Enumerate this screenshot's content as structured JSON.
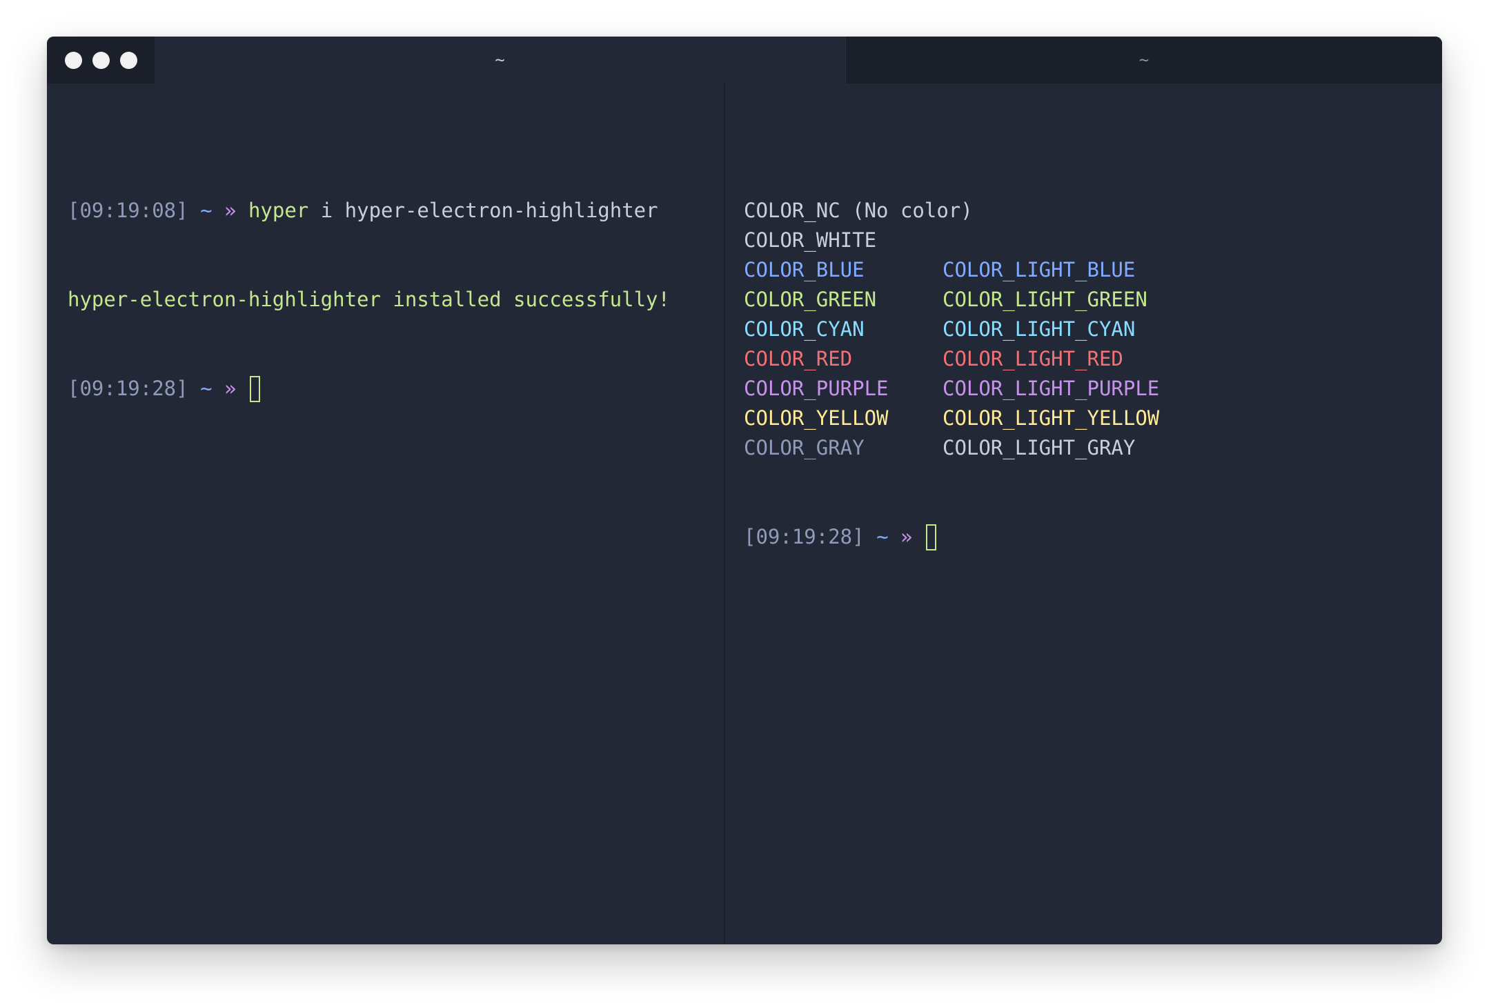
{
  "window": {
    "tabs": [
      {
        "label": "~",
        "active": true
      },
      {
        "label": "~",
        "active": false
      }
    ]
  },
  "colors": {
    "background": "#222836",
    "titlebar": "#1b1f29",
    "timestamp": "#8f9bb8",
    "tilde": "#82aaff",
    "prompt_chevron": "#c792ea",
    "command": "#c3e88d",
    "success": "#c3e88d"
  },
  "left_pane": {
    "line1": {
      "timestamp": "[09:19:08]",
      "tilde": "~",
      "chevron": "»",
      "command": "hyper",
      "args": "i hyper-electron-highlighter"
    },
    "line2": {
      "output": "hyper-electron-highlighter installed successfully!"
    },
    "line3": {
      "timestamp": "[09:19:28]",
      "tilde": "~",
      "chevron": "»"
    }
  },
  "right_pane": {
    "rows": [
      {
        "c1": "COLOR_NC (No color)",
        "c1_color": "#c8cfdc",
        "c2": "",
        "c2_color": "#c8cfdc"
      },
      {
        "c1": "COLOR_WHITE",
        "c1_color": "#c8cfdc",
        "c2": "",
        "c2_color": "#c8cfdc"
      },
      {
        "c1": "COLOR_BLUE",
        "c1_color": "#82aaff",
        "c2": "COLOR_LIGHT_BLUE",
        "c2_color": "#82aaff"
      },
      {
        "c1": "COLOR_GREEN",
        "c1_color": "#c3e88d",
        "c2": "COLOR_LIGHT_GREEN",
        "c2_color": "#c3e88d"
      },
      {
        "c1": "COLOR_CYAN",
        "c1_color": "#89ddff",
        "c2": "COLOR_LIGHT_CYAN",
        "c2_color": "#89ddff"
      },
      {
        "c1": "COLOR_RED",
        "c1_color": "#f07178",
        "c2": "COLOR_LIGHT_RED",
        "c2_color": "#f07178"
      },
      {
        "c1": "COLOR_PURPLE",
        "c1_color": "#c792ea",
        "c2": "COLOR_LIGHT_PURPLE",
        "c2_color": "#c792ea"
      },
      {
        "c1": "COLOR_YELLOW",
        "c1_color": "#ffeb95",
        "c2": "COLOR_LIGHT_YELLOW",
        "c2_color": "#ffeb95"
      },
      {
        "c1": "COLOR_GRAY",
        "c1_color": "#8f9bb8",
        "c2": "COLOR_LIGHT_GRAY",
        "c2_color": "#c8cfdc"
      }
    ],
    "prompt": {
      "timestamp": "[09:19:28]",
      "tilde": "~",
      "chevron": "»"
    }
  }
}
